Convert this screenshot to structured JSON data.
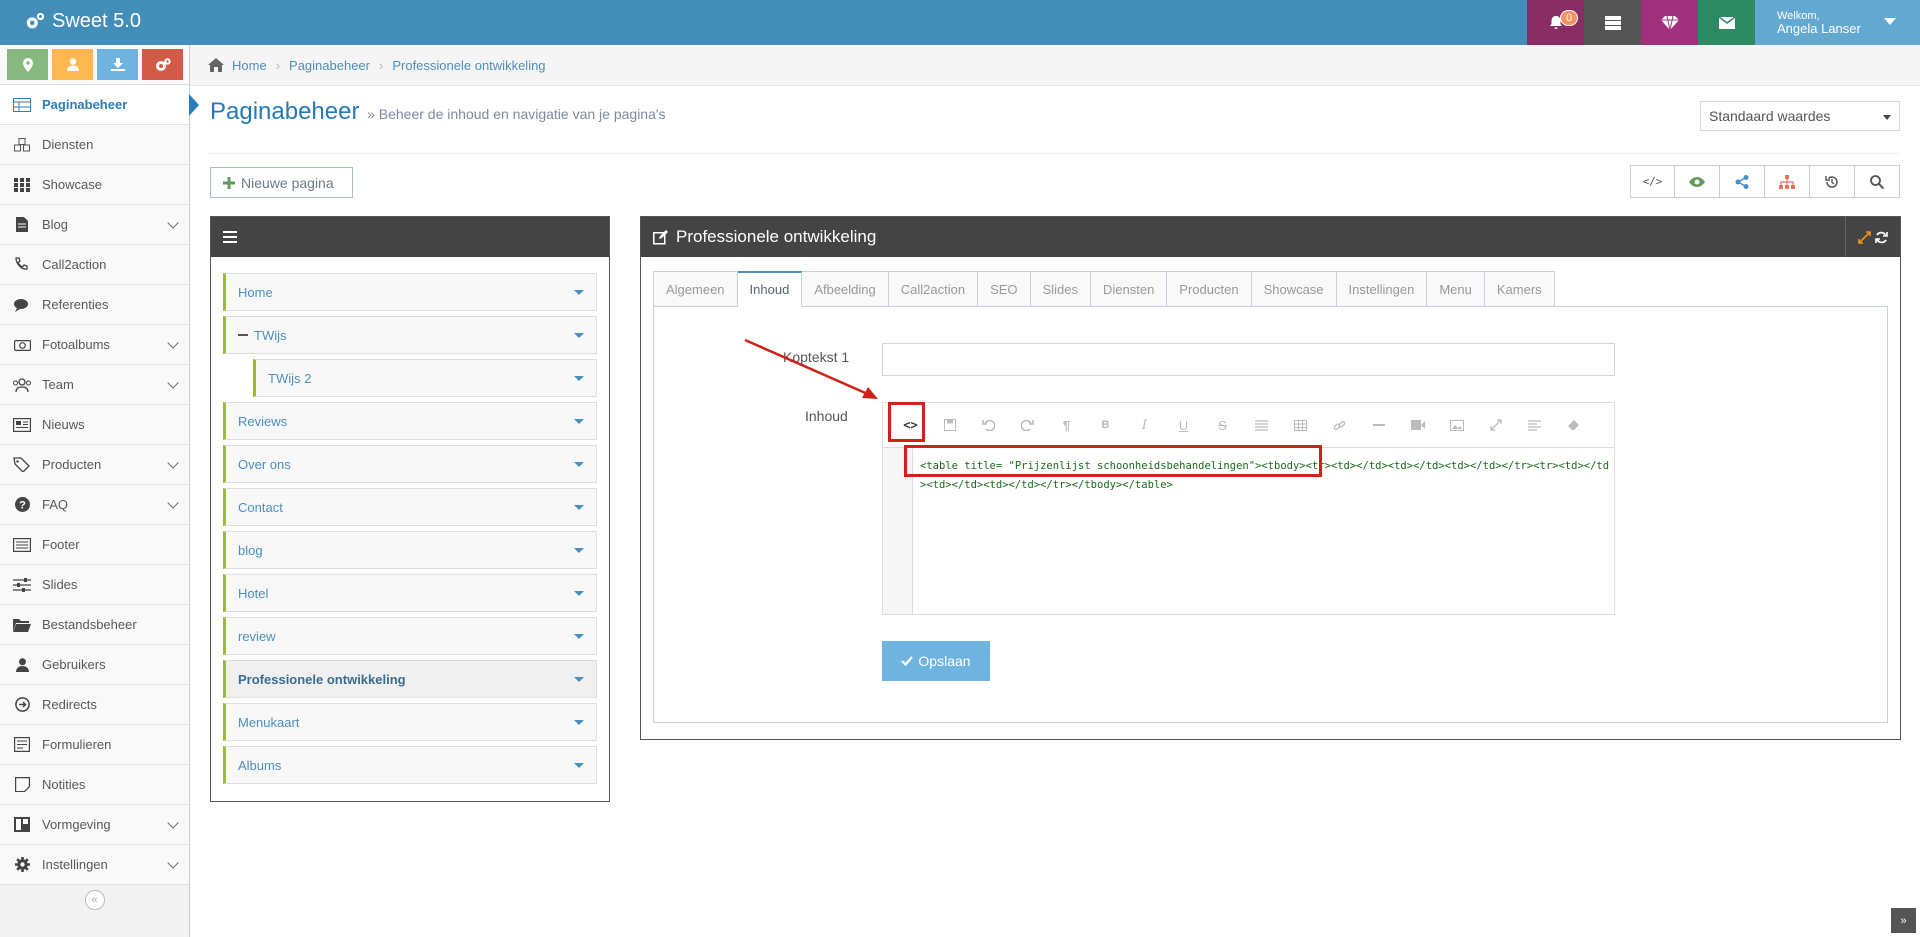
{
  "app": {
    "title": "Sweet 5.0"
  },
  "topnav": {
    "notifications_count": "0",
    "welcome": "Welkom,",
    "user_name": "Angela Lanser"
  },
  "sidebar": {
    "items": [
      {
        "label": "Paginabeheer",
        "icon": "table-icon",
        "active": true
      },
      {
        "label": "Diensten",
        "icon": "cubes-icon"
      },
      {
        "label": "Showcase",
        "icon": "grid-icon"
      },
      {
        "label": "Blog",
        "icon": "file-icon",
        "has_children": true
      },
      {
        "label": "Call2action",
        "icon": "phone-icon"
      },
      {
        "label": "Referenties",
        "icon": "comments-icon"
      },
      {
        "label": "Fotoalbums",
        "icon": "camera-icon",
        "has_children": true
      },
      {
        "label": "Team",
        "icon": "users-icon",
        "has_children": true
      },
      {
        "label": "Nieuws",
        "icon": "newspaper-icon"
      },
      {
        "label": "Producten",
        "icon": "tags-icon",
        "has_children": true
      },
      {
        "label": "FAQ",
        "icon": "question-icon",
        "has_children": true
      },
      {
        "label": "Footer",
        "icon": "list-alt-icon"
      },
      {
        "label": "Slides",
        "icon": "sliders-icon"
      },
      {
        "label": "Bestandsbeheer",
        "icon": "folder-open-icon"
      },
      {
        "label": "Gebruikers",
        "icon": "user-icon"
      },
      {
        "label": "Redirects",
        "icon": "arrow-circle-icon"
      },
      {
        "label": "Formulieren",
        "icon": "form-icon"
      },
      {
        "label": "Notities",
        "icon": "sticky-note-icon"
      },
      {
        "label": "Vormgeving",
        "icon": "layout-icon",
        "has_children": true
      },
      {
        "label": "Instellingen",
        "icon": "gear-icon",
        "has_children": true
      }
    ]
  },
  "breadcrumb": [
    "Home",
    "Paginabeheer",
    "Professionele ontwikkeling"
  ],
  "page": {
    "title": "Paginabeheer",
    "subtitle": "» Beheer de inhoud en navigatie van je pagina's",
    "select_value": "Standaard waardes",
    "new_page_label": "Nieuwe pagina"
  },
  "tree": {
    "nodes": [
      {
        "label": "Home"
      },
      {
        "label": "TWijs",
        "expanded": true
      },
      {
        "label": "TWijs 2",
        "sub": true
      },
      {
        "label": "Reviews"
      },
      {
        "label": "Over ons"
      },
      {
        "label": "Contact"
      },
      {
        "label": "blog"
      },
      {
        "label": "Hotel"
      },
      {
        "label": "review"
      },
      {
        "label": "Professionele ontwikkeling",
        "active": true
      },
      {
        "label": "Menukaart"
      },
      {
        "label": "Albums"
      }
    ]
  },
  "editor_panel": {
    "title": "Professionele ontwikkeling",
    "tabs": [
      "Algemeen",
      "Inhoud",
      "Afbeelding",
      "Call2action",
      "SEO",
      "Slides",
      "Diensten",
      "Producten",
      "Showcase",
      "Instellingen",
      "Menu",
      "Kamers"
    ],
    "active_tab": "Inhoud",
    "field_koptekst_label": "Koptekst 1",
    "field_koptekst_value": "",
    "field_inhoud_label": "Inhoud",
    "code_content": "<table title= \"Prijzenlijst schoonheidsbehandelingen\"><tbody><tr><td></td><td></td><td></td></tr><tr><td></td><td></td><td></td></tr></tbody></table>",
    "save_label": "Opslaan"
  },
  "colors": {
    "topbar": "#438eb9",
    "accent": "#2b7dbc",
    "highlight": "#d0201a"
  }
}
